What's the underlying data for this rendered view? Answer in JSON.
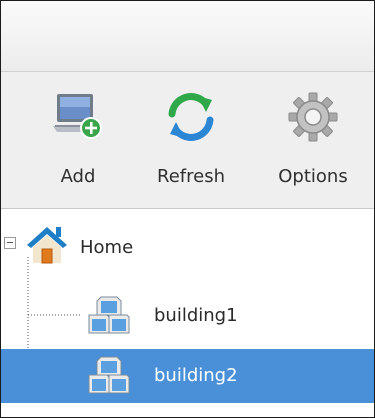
{
  "toolbar": {
    "add_label": "Add",
    "refresh_label": "Refresh",
    "options_label": "Options"
  },
  "tree": {
    "root": {
      "label": "Home",
      "icon": "home-icon",
      "expanded": true
    },
    "children": [
      {
        "label": "building1",
        "icon": "building-icon",
        "selected": false
      },
      {
        "label": "building2",
        "icon": "building-icon",
        "selected": true
      }
    ]
  },
  "colors": {
    "selection": "#4a90d9",
    "roof": "#1f7fc6",
    "door": "#e07a1c",
    "add_badge": "#3aa54a",
    "refresh_green": "#2fa84a",
    "refresh_blue": "#2b86d4"
  }
}
